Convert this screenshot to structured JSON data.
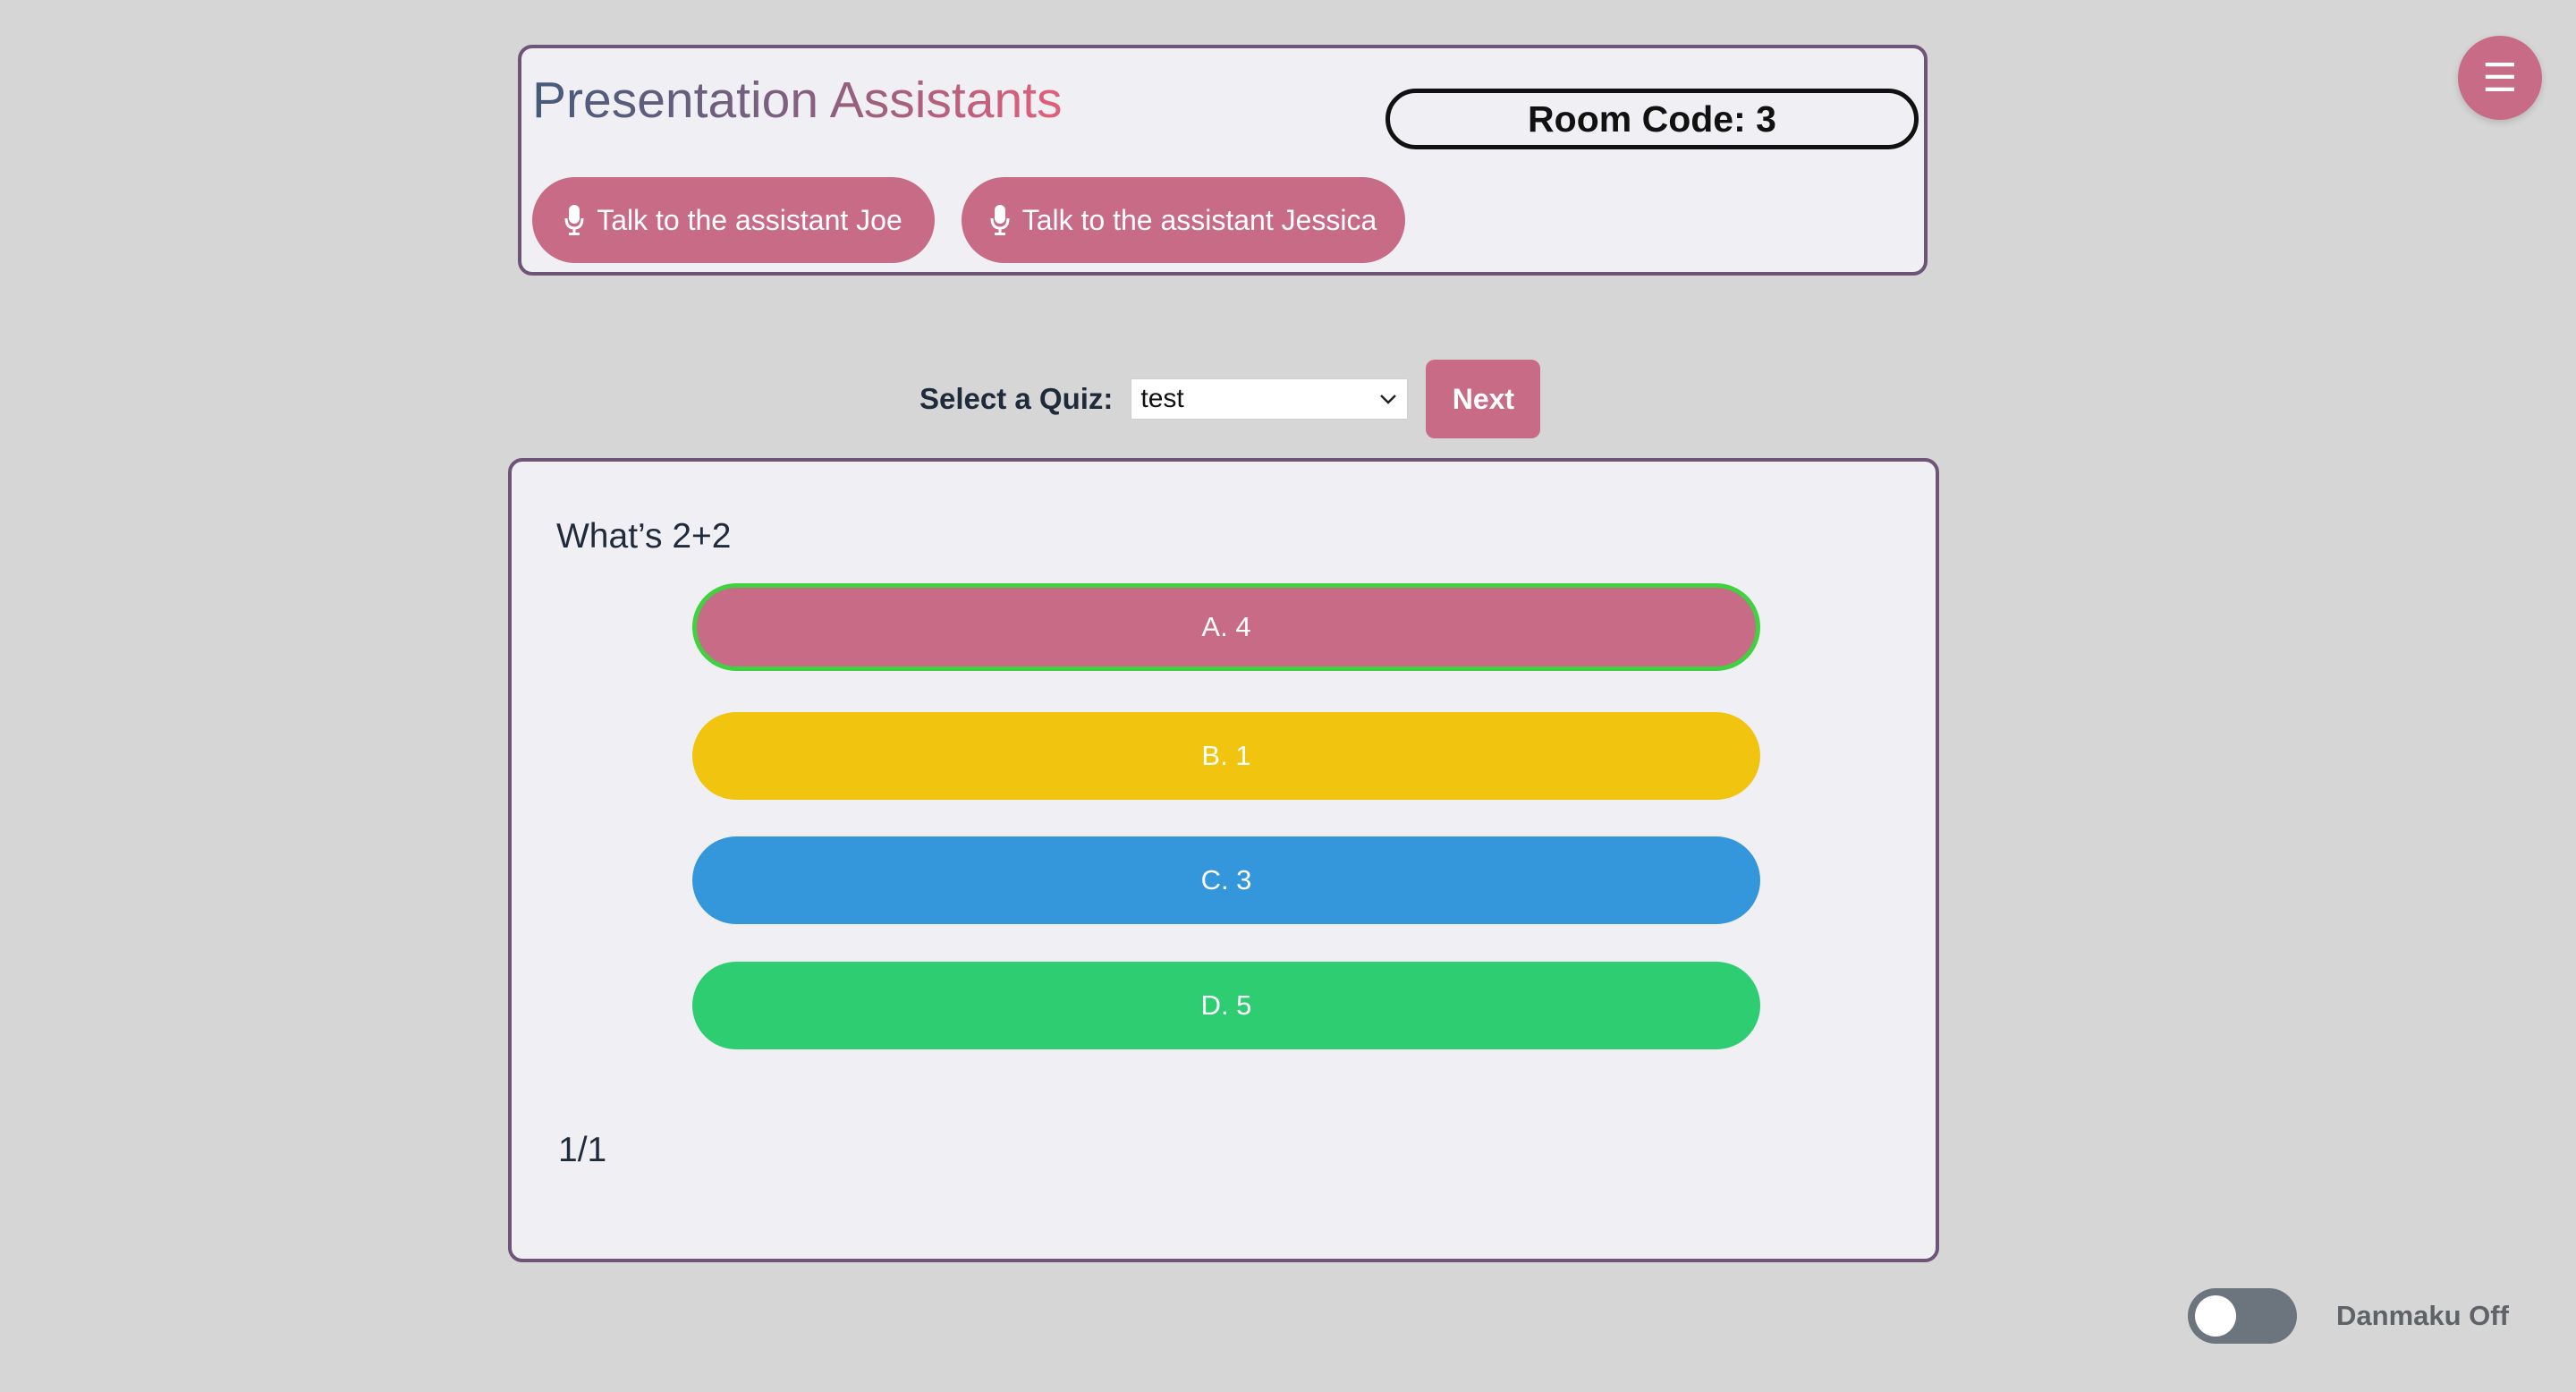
{
  "header": {
    "title": "Presentation Assistants",
    "room_code": "Room Code: 3",
    "assistant_buttons": [
      {
        "label": "Talk to the assistant Joe",
        "icon": "microphone-icon"
      },
      {
        "label": "Talk to the assistant Jessica",
        "icon": "microphone-icon"
      }
    ]
  },
  "menu": {
    "icon": "☰"
  },
  "quiz_selector": {
    "label": "Select a Quiz:",
    "selected": "test",
    "next_label": "Next"
  },
  "quiz": {
    "question": "What’s 2+2",
    "options": [
      {
        "label": "A. 4",
        "color": "#c76b86",
        "selected": true,
        "border_color": "#3fd13f"
      },
      {
        "label": "B. 1",
        "color": "#f0c40f"
      },
      {
        "label": "C. 3",
        "color": "#3597db"
      },
      {
        "label": "D. 5",
        "color": "#2ecd71"
      }
    ],
    "progress": "1/1"
  },
  "danmaku": {
    "label": "Danmaku Off",
    "enabled": false
  },
  "colors": {
    "accent": "#c76b86",
    "card_border": "#6e5477",
    "background": "#d6d6d6",
    "card_background": "#f0f0f4"
  }
}
